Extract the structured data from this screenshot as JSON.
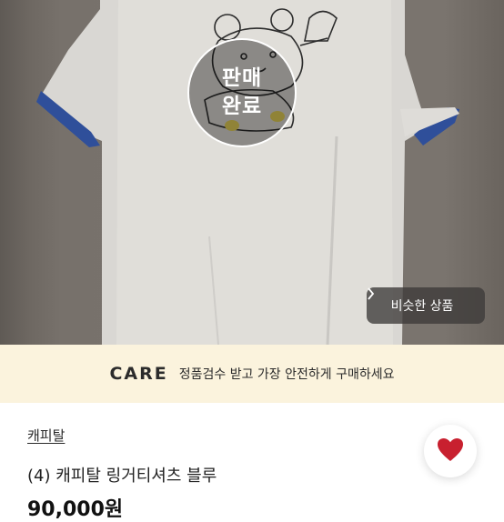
{
  "product_image": {
    "sold_badge": [
      "판매",
      "완료"
    ],
    "similar_button": "비슷한 상품"
  },
  "care": {
    "logo": "CARE",
    "text": "정품검수 받고 가장 안전하게 구매하세요"
  },
  "product": {
    "store": "캐피탈",
    "title": "(4) 캐피탈 링거티셔츠 블루",
    "price": "90,000원"
  },
  "colors": {
    "care_bg": "#fbf3dd",
    "heart": "#c8202f",
    "shirt_trim": "#2f4f9a"
  },
  "icons": {
    "similar_chevron": "chevron-right-icon",
    "like": "heart-icon"
  }
}
